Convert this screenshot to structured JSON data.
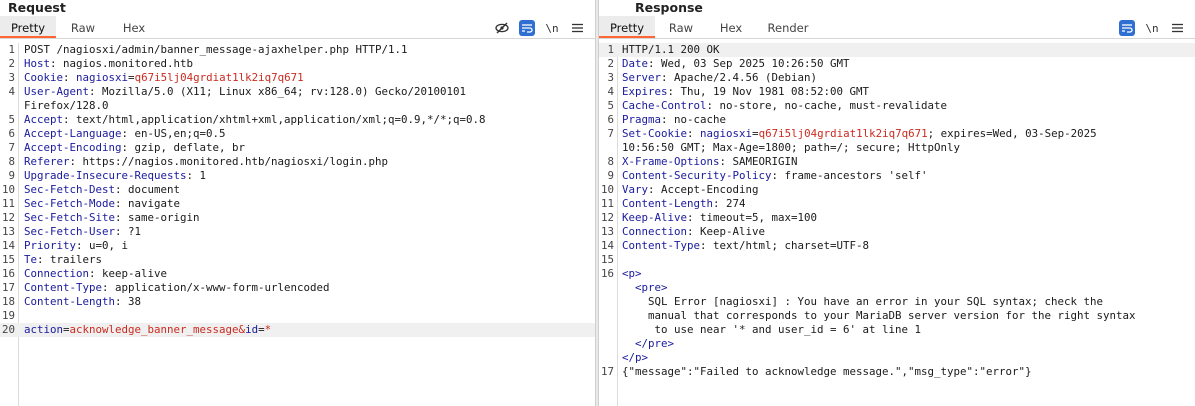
{
  "request": {
    "title": "Request",
    "tabs": [
      "Pretty",
      "Raw",
      "Hex"
    ],
    "line_numbers": [
      "1",
      "2",
      "3",
      "4",
      "",
      "5",
      "6",
      "7",
      "8",
      "9",
      "10",
      "11",
      "12",
      "13",
      "14",
      "15",
      "16",
      "17",
      "18",
      "19",
      "20"
    ],
    "lines": [
      {
        "text": "POST /nagiosxi/admin/banner_message-ajaxhelper.php HTTP/1.1"
      },
      {
        "name": "Host",
        "value": "nagios.monitored.htb"
      },
      {
        "name": "Cookie",
        "cookie_name": "nagiosxi",
        "cookie_value": "q67i5lj04grdiat1lk2iq7q671"
      },
      {
        "name": "User-Agent",
        "value": "Mozilla/5.0 (X11; Linux x86_64; rv:128.0) Gecko/20100101"
      },
      {
        "text": "Firefox/128.0"
      },
      {
        "name": "Accept",
        "value": "text/html,application/xhtml+xml,application/xml;q=0.9,*/*;q=0.8"
      },
      {
        "name": "Accept-Language",
        "value": "en-US,en;q=0.5"
      },
      {
        "name": "Accept-Encoding",
        "value": "gzip, deflate, br"
      },
      {
        "name": "Referer",
        "value": "https://nagios.monitored.htb/nagiosxi/login.php"
      },
      {
        "name": "Upgrade-Insecure-Requests",
        "value": "1"
      },
      {
        "name": "Sec-Fetch-Dest",
        "value": "document"
      },
      {
        "name": "Sec-Fetch-Mode",
        "value": "navigate"
      },
      {
        "name": "Sec-Fetch-Site",
        "value": "same-origin"
      },
      {
        "name": "Sec-Fetch-User",
        "value": "?1"
      },
      {
        "name": "Priority",
        "value": "u=0, i"
      },
      {
        "name": "Te",
        "value": "trailers"
      },
      {
        "name": "Connection",
        "value": "keep-alive"
      },
      {
        "name": "Content-Type",
        "value": "application/x-www-form-urlencoded"
      },
      {
        "name": "Content-Length",
        "value": "38"
      },
      {
        "text": ""
      },
      {
        "param1": "action",
        "value1": "acknowledge_banner_message",
        "sep": "&",
        "param2": "id",
        "value2": "*"
      }
    ]
  },
  "response": {
    "title": "Response",
    "tabs": [
      "Pretty",
      "Raw",
      "Hex",
      "Render"
    ],
    "line_numbers": [
      "1",
      "2",
      "3",
      "4",
      "5",
      "6",
      "7",
      "",
      "8",
      "9",
      "10",
      "11",
      "12",
      "13",
      "14",
      "15",
      "16",
      "",
      "",
      "",
      "",
      "",
      "",
      "17"
    ],
    "lines": [
      {
        "text": "HTTP/1.1 200 OK"
      },
      {
        "name": "Date",
        "value": "Wed, 03 Sep 2025 10:26:50 GMT"
      },
      {
        "name": "Server",
        "value": "Apache/2.4.56 (Debian)"
      },
      {
        "name": "Expires",
        "value": "Thu, 19 Nov 1981 08:52:00 GMT"
      },
      {
        "name": "Cache-Control",
        "value": "no-store, no-cache, must-revalidate"
      },
      {
        "name": "Pragma",
        "value": "no-cache"
      },
      {
        "name": "Set-Cookie",
        "cookie_name": "nagiosxi",
        "cookie_value": "q67i5lj04grdiat1lk2iq7q671",
        "rest": "; expires=Wed, 03-Sep-2025"
      },
      {
        "text": "10:56:50 GMT; Max-Age=1800; path=/; secure; HttpOnly"
      },
      {
        "name": "X-Frame-Options",
        "value": "SAMEORIGIN"
      },
      {
        "name": "Content-Security-Policy",
        "value": "frame-ancestors 'self'"
      },
      {
        "name": "Vary",
        "value": "Accept-Encoding"
      },
      {
        "name": "Content-Length",
        "value": "274"
      },
      {
        "name": "Keep-Alive",
        "value": "timeout=5, max=100"
      },
      {
        "name": "Connection",
        "value": "Keep-Alive"
      },
      {
        "name": "Content-Type",
        "value": "text/html; charset=UTF-8"
      },
      {
        "text": ""
      },
      {
        "tag": "<p>"
      },
      {
        "tag": "<pre>",
        "indent": "  "
      },
      {
        "text": "    SQL Error [nagiosxi] : You have an error in your SQL syntax; check the"
      },
      {
        "text": "    manual that corresponds to your MariaDB server version for the right syntax"
      },
      {
        "text": "     to use near '* and user_id = 6' at line 1"
      },
      {
        "tag": "</pre>",
        "indent": "  "
      },
      {
        "tag": "</p>"
      },
      {
        "text": "{\"message\":\"Failed to acknowledge message.\",\"msg_type\":\"error\"}"
      }
    ]
  },
  "toolbar": {
    "hide_icon_glyph": "⊘",
    "wrap_icon_glyph": "↵",
    "newline_label": "\\n",
    "menu_icon_glyph": "≡"
  },
  "colors": {
    "header_name": "#1a1a9e",
    "value_red": "#cc2a1f",
    "active_tab_underline": "#ff6633",
    "toolbar_active": "#2e6fd1"
  }
}
